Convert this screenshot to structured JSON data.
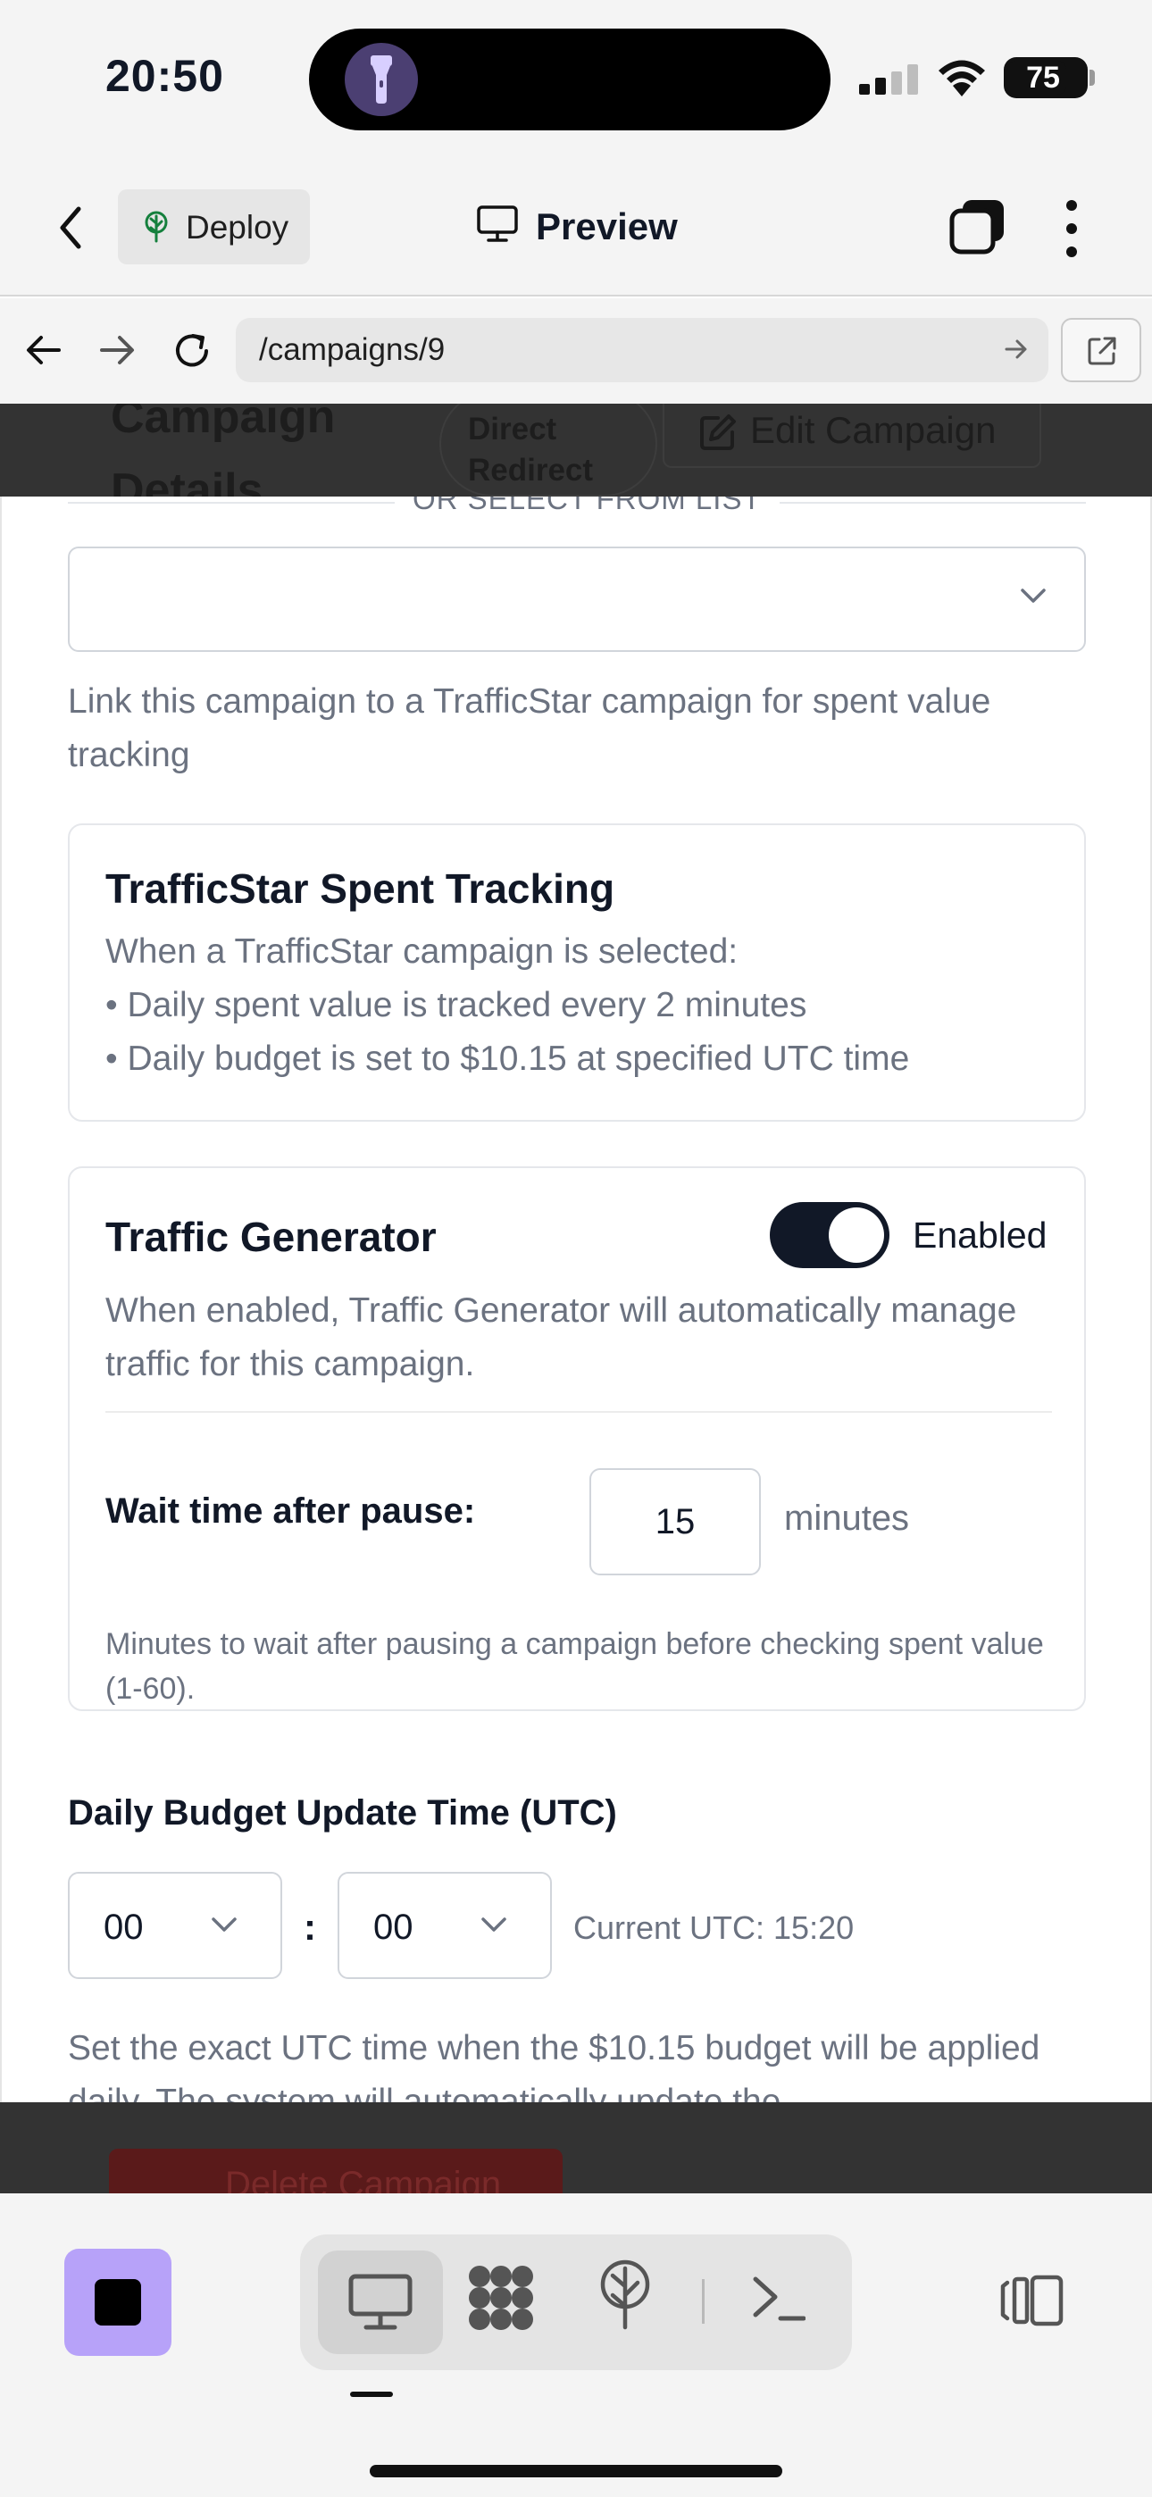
{
  "status_bar": {
    "time": "20:50",
    "battery": "75",
    "icons": [
      "flashlight-icon",
      "signal-icon",
      "wifi-icon",
      "battery-icon"
    ]
  },
  "header": {
    "deploy_label": "Deploy",
    "preview_label": "Preview",
    "icons": [
      "back-chevron-icon",
      "deploy-tree-icon",
      "monitor-icon",
      "tabs-icon",
      "kebab-menu-icon"
    ]
  },
  "browser": {
    "url": "/campaigns/9",
    "icons": [
      "arrow-left-icon",
      "arrow-right-icon",
      "reload-icon",
      "url-go-arrow-icon",
      "open-external-icon"
    ]
  },
  "page_behind": {
    "title": "Campaign Details",
    "badge": "Direct Redirect",
    "edit_label": "Edit Campaign",
    "delete_label": "Delete Campaign"
  },
  "form": {
    "divider_text": "OR SELECT FROM LIST",
    "select_value": "",
    "select_helper": "Link this campaign to a TrafficStar campaign for spent value tracking",
    "spent_tracking": {
      "title": "TrafficStar Spent Tracking",
      "intro": "When a TrafficStar campaign is selected:",
      "bullet_1": "• Daily spent value is tracked every 2 minutes",
      "bullet_2": "• Daily budget is set to $10.15 at specified UTC time"
    },
    "traffic_generator": {
      "title": "Traffic Generator",
      "enabled": true,
      "toggle_label": "Enabled",
      "description": "When enabled, Traffic Generator will automatically manage traffic for this campaign.",
      "wait_label": "Wait time after pause:",
      "wait_value": "15",
      "wait_unit": "minutes",
      "wait_hint": "Minutes to wait after pausing a campaign before checking spent value (1-60)."
    },
    "budget_time": {
      "label": "Daily Budget Update Time (UTC)",
      "hour": "00",
      "minute": "00",
      "colon": ":",
      "current_utc": "Current UTC: 15:20",
      "help": "Set the exact UTC time when the $10.15 budget will be applied daily. The system will automatically update the"
    }
  },
  "toolbar": {
    "icons": [
      "stop-icon",
      "desktop-icon",
      "grid-icon",
      "network-icon",
      "terminal-icon",
      "panel-toggle-icon"
    ],
    "active_tool": "desktop",
    "accent": "#b7a2f9"
  },
  "colors": {
    "text": "#111827",
    "muted": "#6b7280",
    "border": "#e5e7eb",
    "toggle_on": "#111827",
    "overlay": "#333333"
  }
}
